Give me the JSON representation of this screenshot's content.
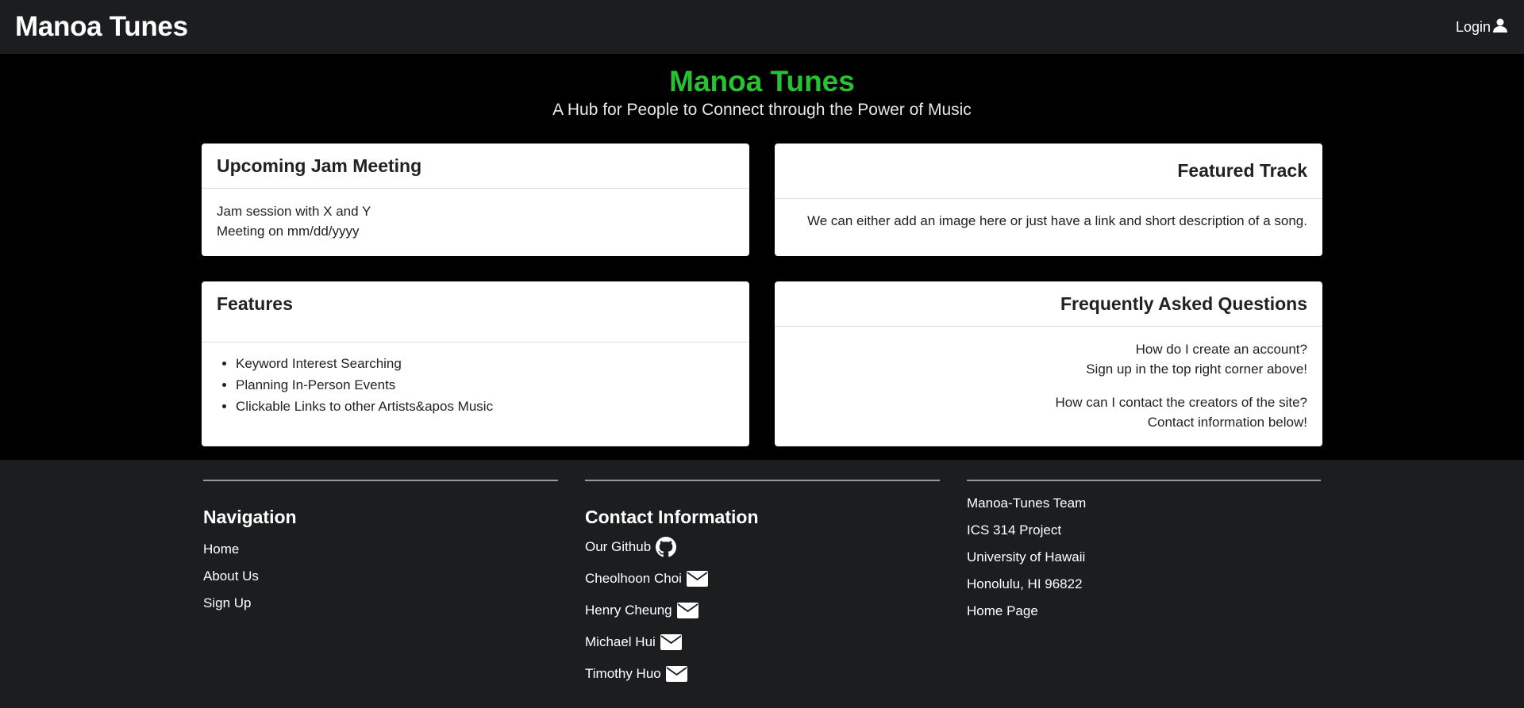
{
  "navbar": {
    "brand": "Manoa Tunes",
    "login_label": "Login",
    "login_icon": "user-icon"
  },
  "hero": {
    "title": "Manoa Tunes",
    "subtitle": "A Hub for People to Connect through the Power of Music",
    "title_color": "#27c232"
  },
  "cards": {
    "jam": {
      "title": "Upcoming Jam Meeting",
      "lines": [
        "Jam session with X and Y",
        "Meeting on mm/dd/yyyy"
      ]
    },
    "featured": {
      "title": "Featured Track",
      "text": "We can either add an image here or just have a link and short description of a song."
    },
    "features": {
      "title": "Features",
      "items": [
        "Keyword Interest Searching",
        "Planning In-Person Events",
        "Clickable Links to other Artists&apos Music"
      ]
    },
    "faq": {
      "title": "Frequently Asked Questions",
      "q1": "How do I create an account?",
      "a1": "Sign up in the top right corner above!",
      "q2": "How can I contact the creators of the site?",
      "a2": "Contact information below!"
    }
  },
  "footer": {
    "navigation": {
      "title": "Navigation",
      "links": [
        "Home",
        "About Us",
        "Sign Up"
      ]
    },
    "contact": {
      "title": "Contact Information",
      "github": "Our Github",
      "people": [
        "Cheolhoon Choi",
        "Henry Cheung",
        "Michael Hui",
        "Timothy Huo"
      ]
    },
    "team": {
      "lines": [
        "Manoa-Tunes Team",
        "ICS 314 Project",
        "University of Hawaii",
        "Honolulu, HI 96822"
      ],
      "home_page": "Home Page"
    }
  }
}
